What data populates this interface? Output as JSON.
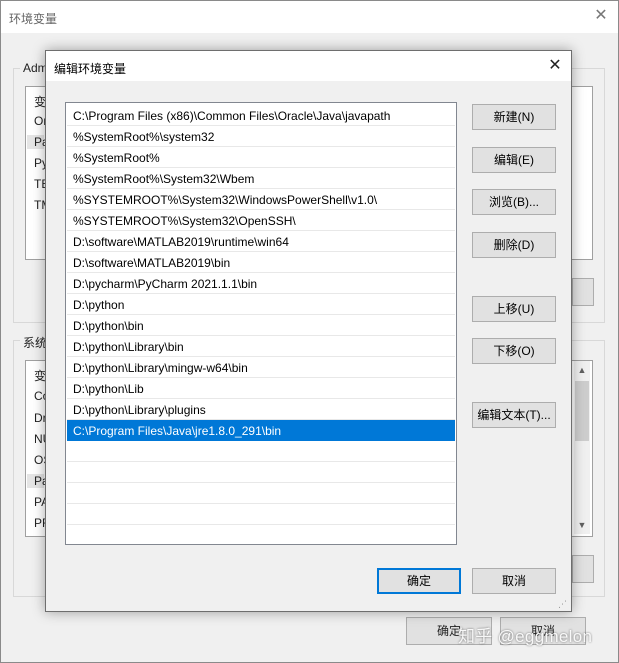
{
  "background_window": {
    "title": "环境变量",
    "user_group_label": "Adm",
    "user_list_cells": [
      "变",
      "On",
      "Pa",
      "Py",
      "TE",
      "TM"
    ],
    "system_group_label": "系统",
    "system_list_cells": [
      "变",
      "Co",
      "Dr",
      "NU",
      "OS",
      "Pa",
      "PA",
      "PR"
    ],
    "ok_label": "确定",
    "cancel_label": "取消"
  },
  "dialog": {
    "title": "编辑环境变量",
    "paths": [
      "C:\\Program Files (x86)\\Common Files\\Oracle\\Java\\javapath",
      "%SystemRoot%\\system32",
      "%SystemRoot%",
      "%SystemRoot%\\System32\\Wbem",
      "%SYSTEMROOT%\\System32\\WindowsPowerShell\\v1.0\\",
      "%SYSTEMROOT%\\System32\\OpenSSH\\",
      "D:\\software\\MATLAB2019\\runtime\\win64",
      "D:\\software\\MATLAB2019\\bin",
      "D:\\pycharm\\PyCharm 2021.1.1\\bin",
      "D:\\python",
      "D:\\python\\bin",
      "D:\\python\\Library\\bin",
      "D:\\python\\Library\\mingw-w64\\bin",
      "D:\\python\\Lib",
      "D:\\python\\Library\\plugins",
      "C:\\Program Files\\Java\\jre1.8.0_291\\bin"
    ],
    "selected_index": 15,
    "buttons": {
      "new": "新建(N)",
      "edit": "编辑(E)",
      "browse": "浏览(B)...",
      "delete": "删除(D)",
      "move_up": "上移(U)",
      "move_down": "下移(O)",
      "edit_text": "编辑文本(T)..."
    },
    "ok_label": "确定",
    "cancel_label": "取消"
  },
  "watermark": "知乎 @eggmelon",
  "colors": {
    "selection": "#0078d7",
    "button_face": "#e1e1e1",
    "window_bg": "#f0f0f0"
  }
}
